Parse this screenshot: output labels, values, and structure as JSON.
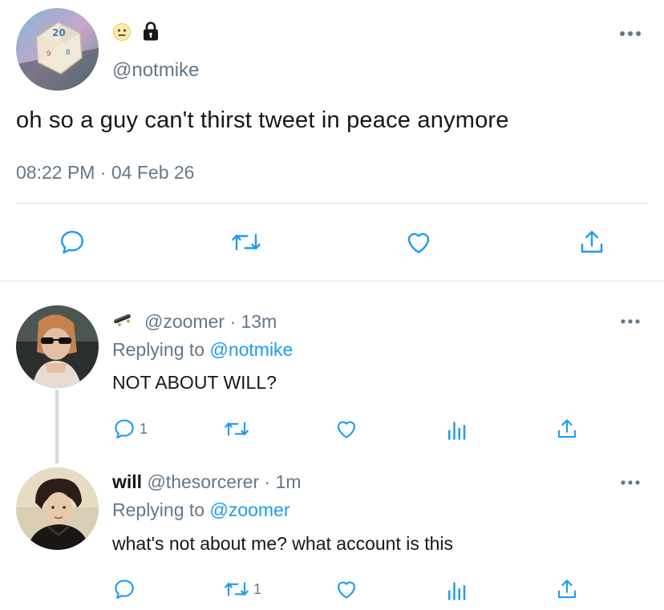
{
  "main_tweet": {
    "handle": "@notmike",
    "text": "oh so a guy can't thirst tweet in peace anymore",
    "timestamp": "08:22 PM · 04 Feb 26",
    "badges": [
      "neutral-face-emoji",
      "lock-icon"
    ]
  },
  "replies": [
    {
      "display_name": "",
      "badge_icon": "skateboard-emoji",
      "handle": "@zoomer",
      "time": "· 13m",
      "replying_prefix": "Replying to",
      "replying_to": "@notmike",
      "text": "NOT ABOUT WILL?",
      "reply_count": "1",
      "retweet_count": ""
    },
    {
      "display_name": "will",
      "handle": "@thesorcerer",
      "time": "· 1m",
      "replying_prefix": "Replying to",
      "replying_to": "@zoomer",
      "text": "what's not about me? what account is this",
      "reply_count": "",
      "retweet_count": "1"
    }
  ],
  "colors": {
    "link": "#1d9bf0",
    "secondary_text": "#657786",
    "icon": "#1d9bf0",
    "divider": "#dfe3e6"
  }
}
